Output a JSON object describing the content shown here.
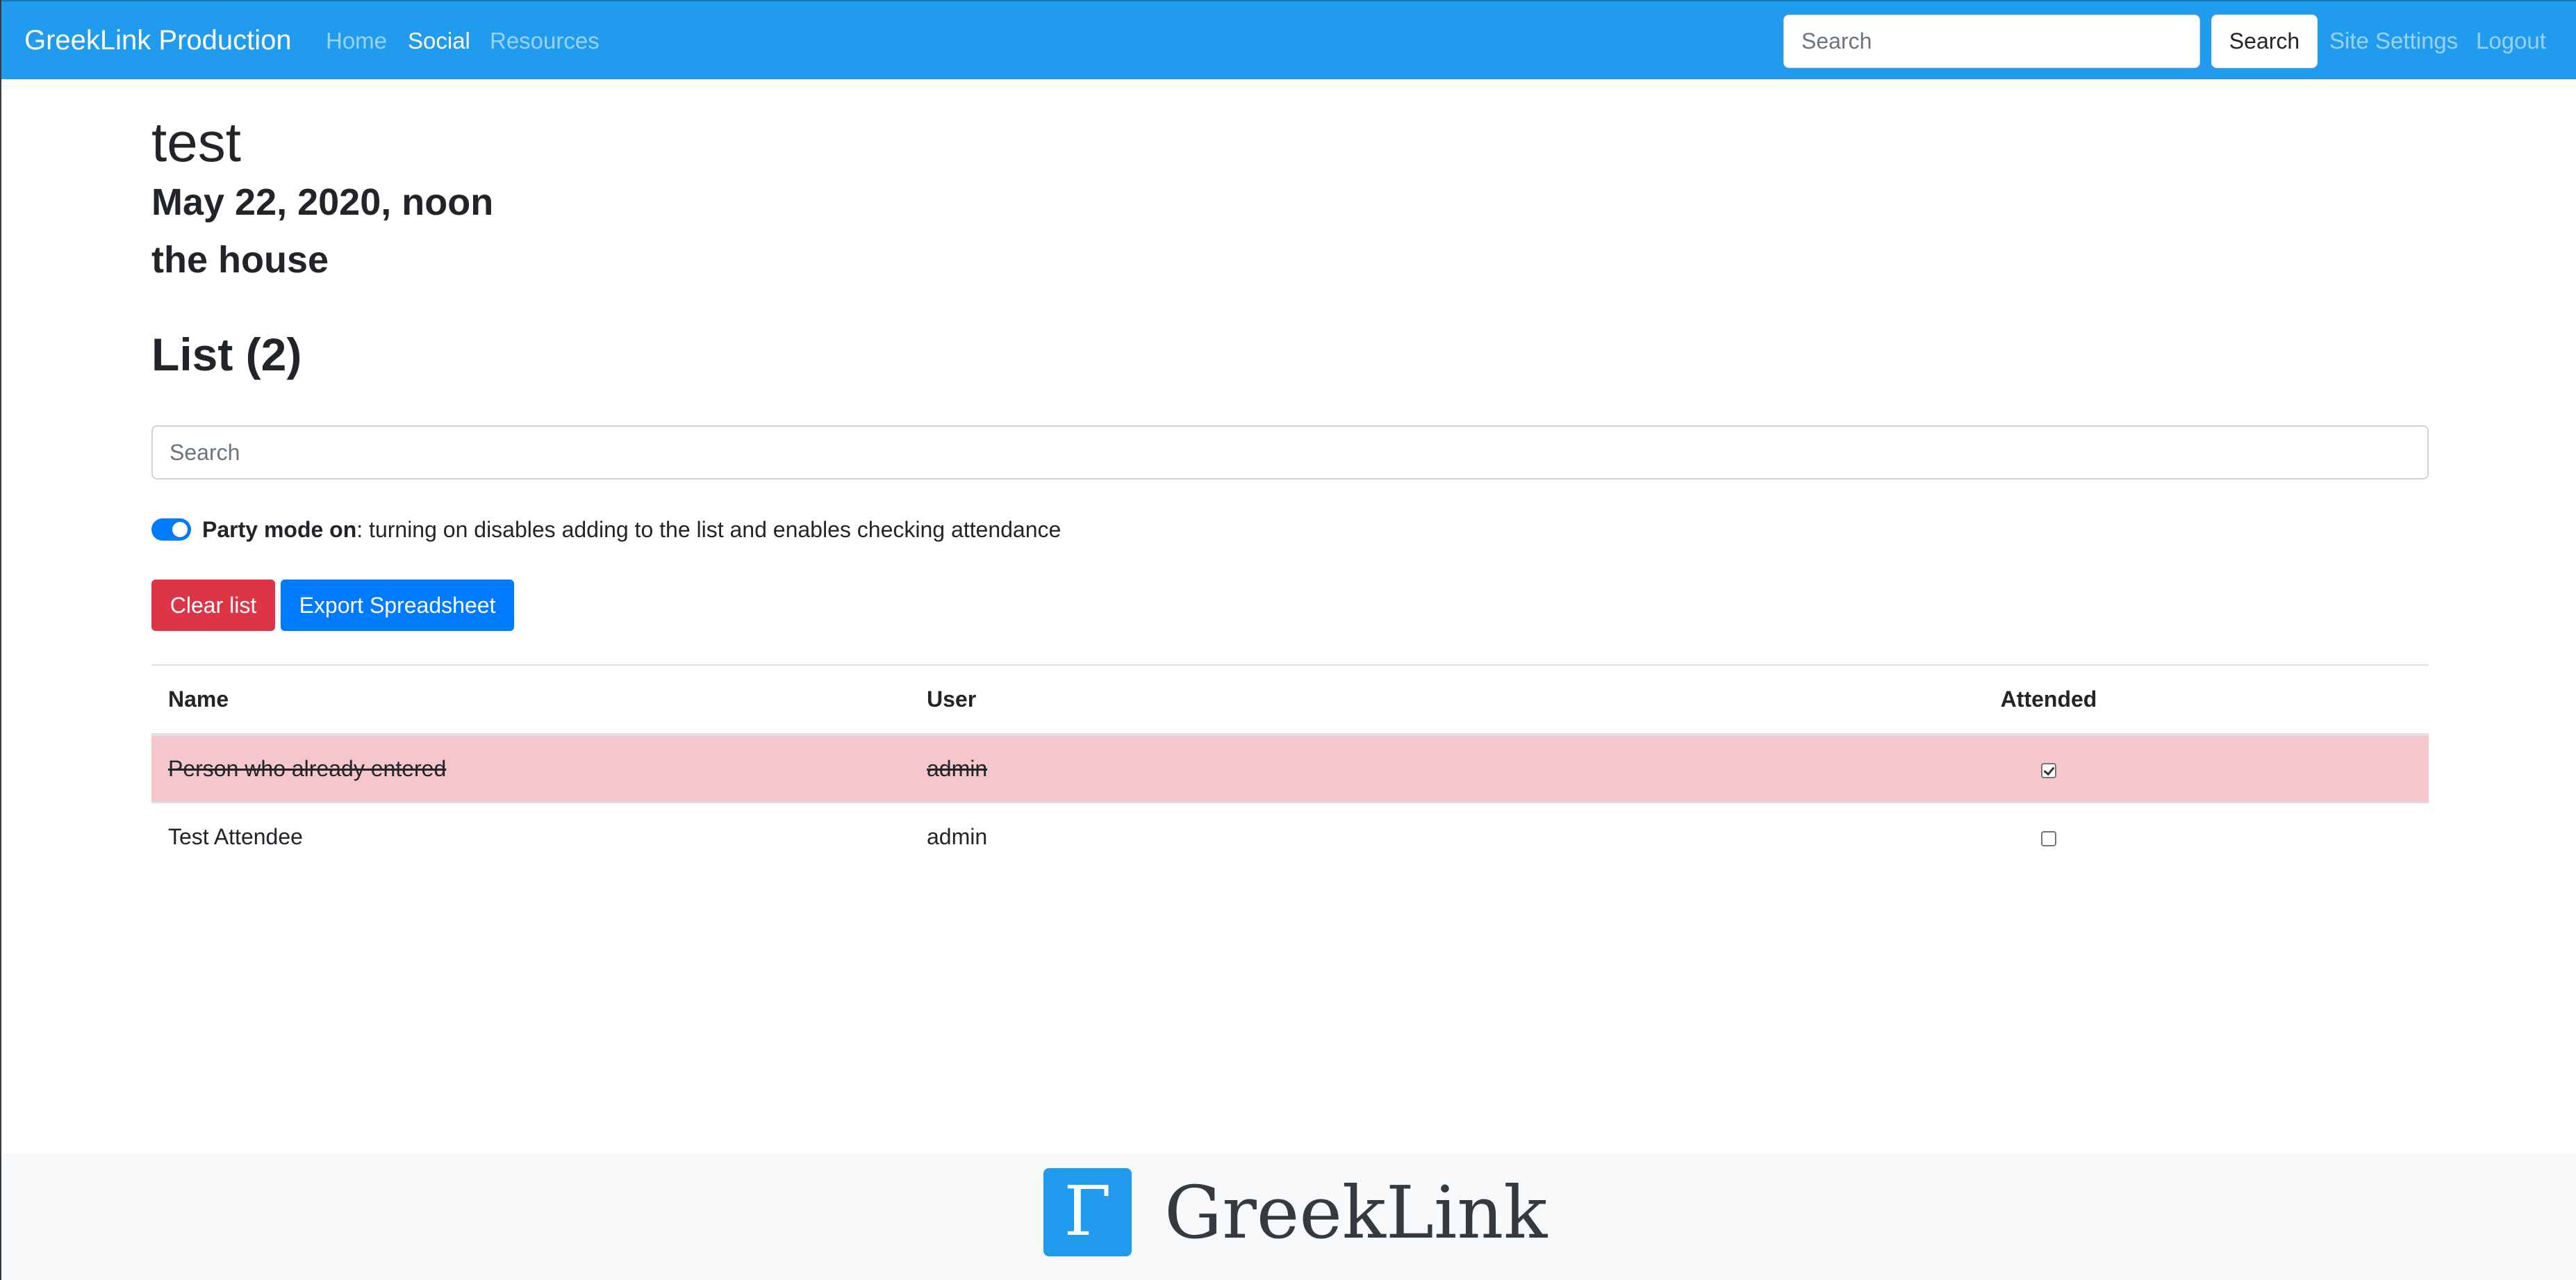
{
  "navbar": {
    "brand": "GreekLink Production",
    "links": [
      {
        "label": "Home",
        "active": false
      },
      {
        "label": "Social",
        "active": true
      },
      {
        "label": "Resources",
        "active": false
      }
    ],
    "search_placeholder": "Search",
    "search_button": "Search",
    "right_links": [
      {
        "label": "Site Settings"
      },
      {
        "label": "Logout"
      }
    ],
    "color": "#219bed"
  },
  "event": {
    "title": "test",
    "date": "May 22, 2020, noon",
    "location": "the house"
  },
  "list": {
    "heading": "List (2)",
    "search_placeholder": "Search",
    "party_mode": {
      "enabled": true,
      "label_bold": "Party mode on",
      "label_rest": ": turning on disables adding to the list and enables checking attendance"
    },
    "buttons": {
      "clear": "Clear list",
      "export": "Export Spreadsheet"
    },
    "table": {
      "headers": [
        "Name",
        "User",
        "Attended"
      ],
      "rows": [
        {
          "name": "Person who already entered",
          "user": "admin",
          "attended": true
        },
        {
          "name": "Test Attendee",
          "user": "admin",
          "attended": false
        }
      ]
    }
  },
  "footer": {
    "logo_glyph": "Γ",
    "name": "GreekLink"
  },
  "colors": {
    "danger": "#dc3545",
    "primary": "#007bff",
    "entered_row": "#f5c6cb"
  },
  "icons": [
    "toggle-switch-icon",
    "checkbox-icon",
    "greeklink-logo-icon"
  ]
}
